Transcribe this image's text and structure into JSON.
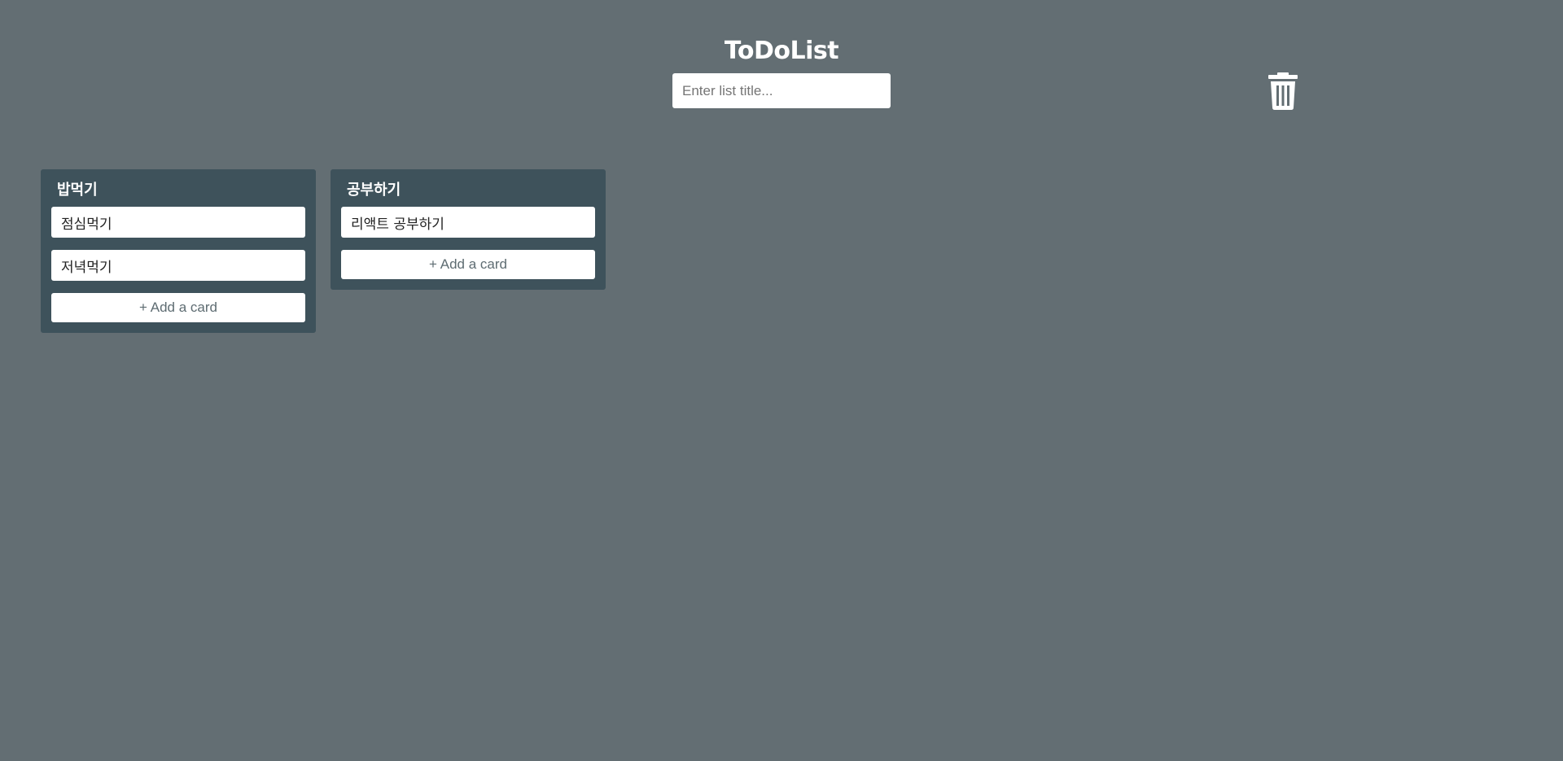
{
  "header": {
    "title": "ToDoList",
    "list_title_placeholder": "Enter list title..."
  },
  "trash": {
    "icon": "trash-icon",
    "color": "#ffffff"
  },
  "lists": [
    {
      "title": "밥먹기",
      "cards": [
        "점심먹기",
        "저녁먹기"
      ],
      "add_card_label": "+ Add a card"
    },
    {
      "title": "공부하기",
      "cards": [
        "리액트 공부하기"
      ],
      "add_card_label": "+ Add a card"
    }
  ],
  "colors": {
    "background": "#636e73",
    "list_background": "#3e525b",
    "card_background": "#ffffff"
  }
}
